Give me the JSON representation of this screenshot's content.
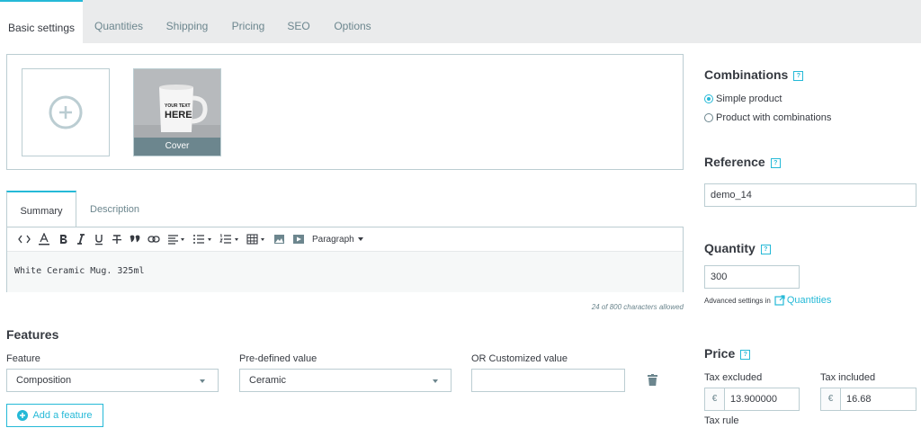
{
  "tabs": [
    {
      "label": "Basic settings"
    },
    {
      "label": "Quantities"
    },
    {
      "label": "Shipping"
    },
    {
      "label": "Pricing"
    },
    {
      "label": "SEO"
    },
    {
      "label": "Options"
    }
  ],
  "gallery": {
    "cover_label": "Cover",
    "mug_text_line1": "YOUR TEXT",
    "mug_text_line2": "HERE"
  },
  "editor": {
    "tabs": [
      {
        "label": "Summary"
      },
      {
        "label": "Description"
      }
    ],
    "paragraph_label": "Paragraph",
    "content": "White Ceramic Mug. 325ml",
    "char_count": "24 of 800 characters allowed"
  },
  "features": {
    "heading": "Features",
    "feature_label": "Feature",
    "predefined_label": "Pre-defined value",
    "custom_label": "OR Customized value",
    "feature_value": "Composition",
    "predefined_value": "Ceramic",
    "add_button": "Add a feature"
  },
  "combinations": {
    "heading": "Combinations",
    "help": "?",
    "options": [
      {
        "label": "Simple product",
        "checked": true
      },
      {
        "label": "Product with combinations",
        "checked": false
      }
    ]
  },
  "reference": {
    "heading": "Reference",
    "help": "?",
    "value": "demo_14"
  },
  "quantity": {
    "heading": "Quantity",
    "help": "?",
    "value": "300",
    "advanced_text": "Advanced settings in",
    "advanced_link": "Quantities"
  },
  "price": {
    "heading": "Price",
    "help": "?",
    "tax_excluded_label": "Tax excluded",
    "tax_included_label": "Tax included",
    "currency": "€",
    "tax_excluded_value": "13.900000",
    "tax_included_value": "16.68",
    "tax_rule_label": "Tax rule"
  },
  "colors": {
    "accent": "#25b9d7",
    "border": "#bbcdd2",
    "muted": "#6c868e"
  }
}
